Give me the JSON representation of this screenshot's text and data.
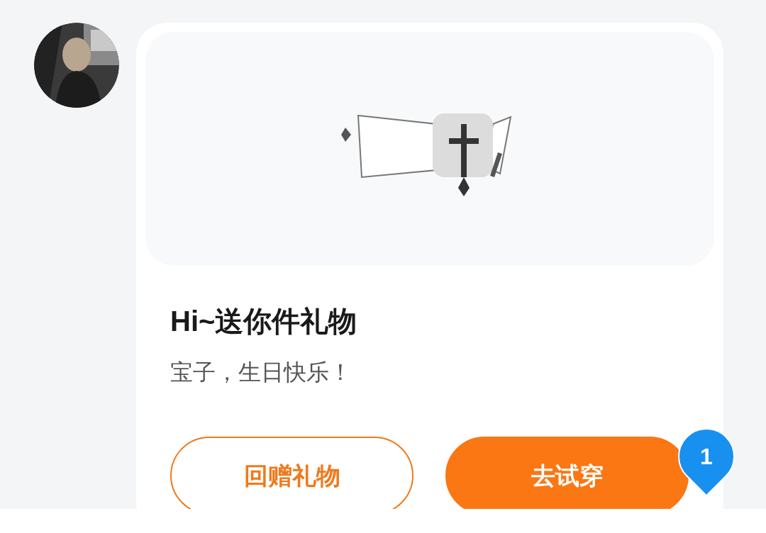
{
  "message": {
    "card": {
      "title": "Hi~送你件礼物",
      "text": "宝子，生日快乐！",
      "buttons": [
        {
          "label": "回赠礼物",
          "kind": "outline"
        },
        {
          "label": "去试穿",
          "kind": "filled",
          "badge": "1"
        }
      ]
    }
  }
}
